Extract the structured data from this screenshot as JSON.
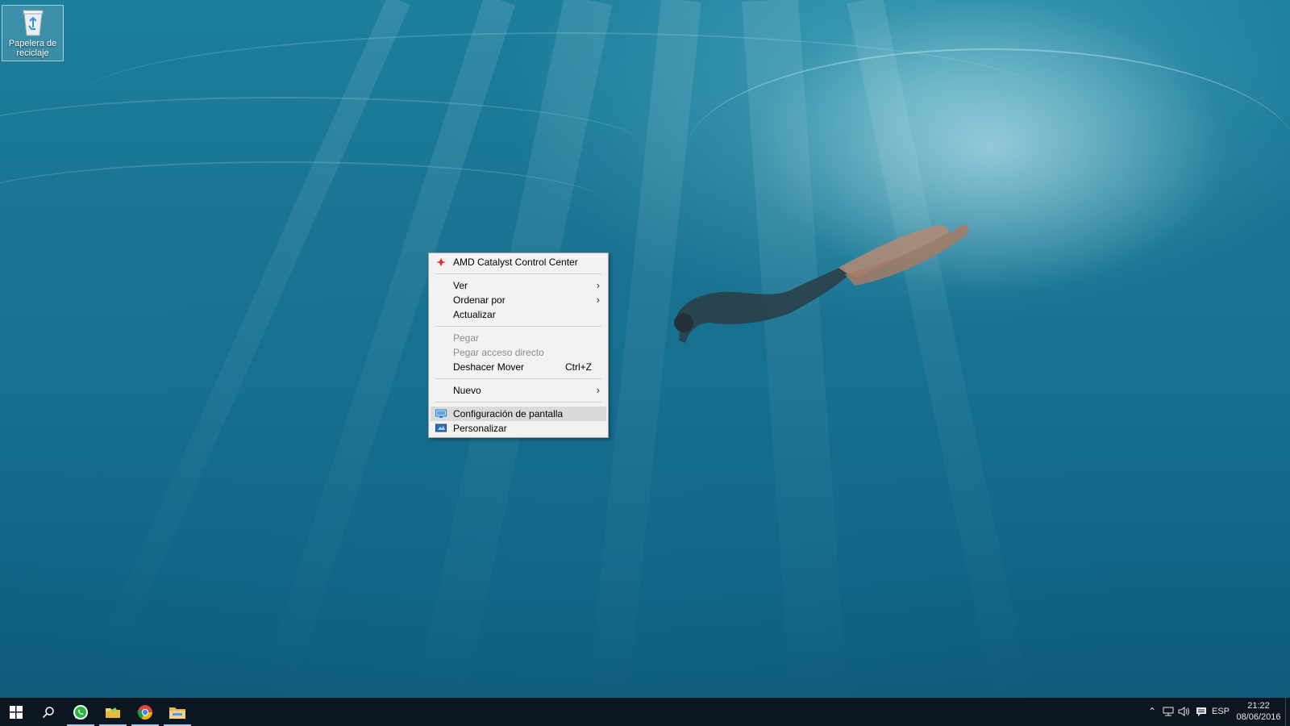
{
  "desktop": {
    "icons": [
      {
        "label": "Papelera de reciclaje",
        "icon": "recycle-bin-icon"
      }
    ]
  },
  "context_menu": {
    "items": [
      {
        "label": "AMD Catalyst Control Center",
        "icon": "amd-catalyst-icon",
        "enabled": true
      },
      {
        "separator": true
      },
      {
        "label": "Ver",
        "submenu": true,
        "enabled": true
      },
      {
        "label": "Ordenar por",
        "submenu": true,
        "enabled": true
      },
      {
        "label": "Actualizar",
        "enabled": true
      },
      {
        "separator": true
      },
      {
        "label": "Pegar",
        "enabled": false
      },
      {
        "label": "Pegar acceso directo",
        "enabled": false
      },
      {
        "label": "Deshacer Mover",
        "shortcut": "Ctrl+Z",
        "enabled": true
      },
      {
        "separator": true
      },
      {
        "label": "Nuevo",
        "submenu": true,
        "enabled": true
      },
      {
        "separator": true
      },
      {
        "label": "Configuración de pantalla",
        "icon": "display-settings-icon",
        "enabled": true,
        "highlighted": true
      },
      {
        "label": "Personalizar",
        "icon": "personalize-icon",
        "enabled": true
      }
    ]
  },
  "taskbar": {
    "buttons": [
      {
        "name": "start-button",
        "icon": "windows-logo-icon",
        "running": false
      },
      {
        "name": "search-button",
        "icon": "search-icon",
        "running": false
      },
      {
        "name": "whatsapp-button",
        "icon": "whatsapp-icon",
        "running": true
      },
      {
        "name": "app-folder-button",
        "icon": "folder-app-icon",
        "running": true
      },
      {
        "name": "chrome-button",
        "icon": "chrome-icon",
        "running": true
      },
      {
        "name": "file-explorer-button",
        "icon": "file-explorer-icon",
        "running": true
      }
    ],
    "tray": {
      "icons": [
        "chevron-up-icon",
        "network-icon",
        "volume-icon",
        "action-center-icon"
      ],
      "language": "ESP",
      "time": "21:22",
      "date": "08/06/2016"
    }
  },
  "colors": {
    "taskbar_bg": "#0c1620",
    "menu_bg": "#f2f2f2",
    "menu_highlight": "#dadada",
    "disabled_text": "#8c8c8c",
    "water_deep": "#126585",
    "water_light": "#7fd0e0"
  }
}
